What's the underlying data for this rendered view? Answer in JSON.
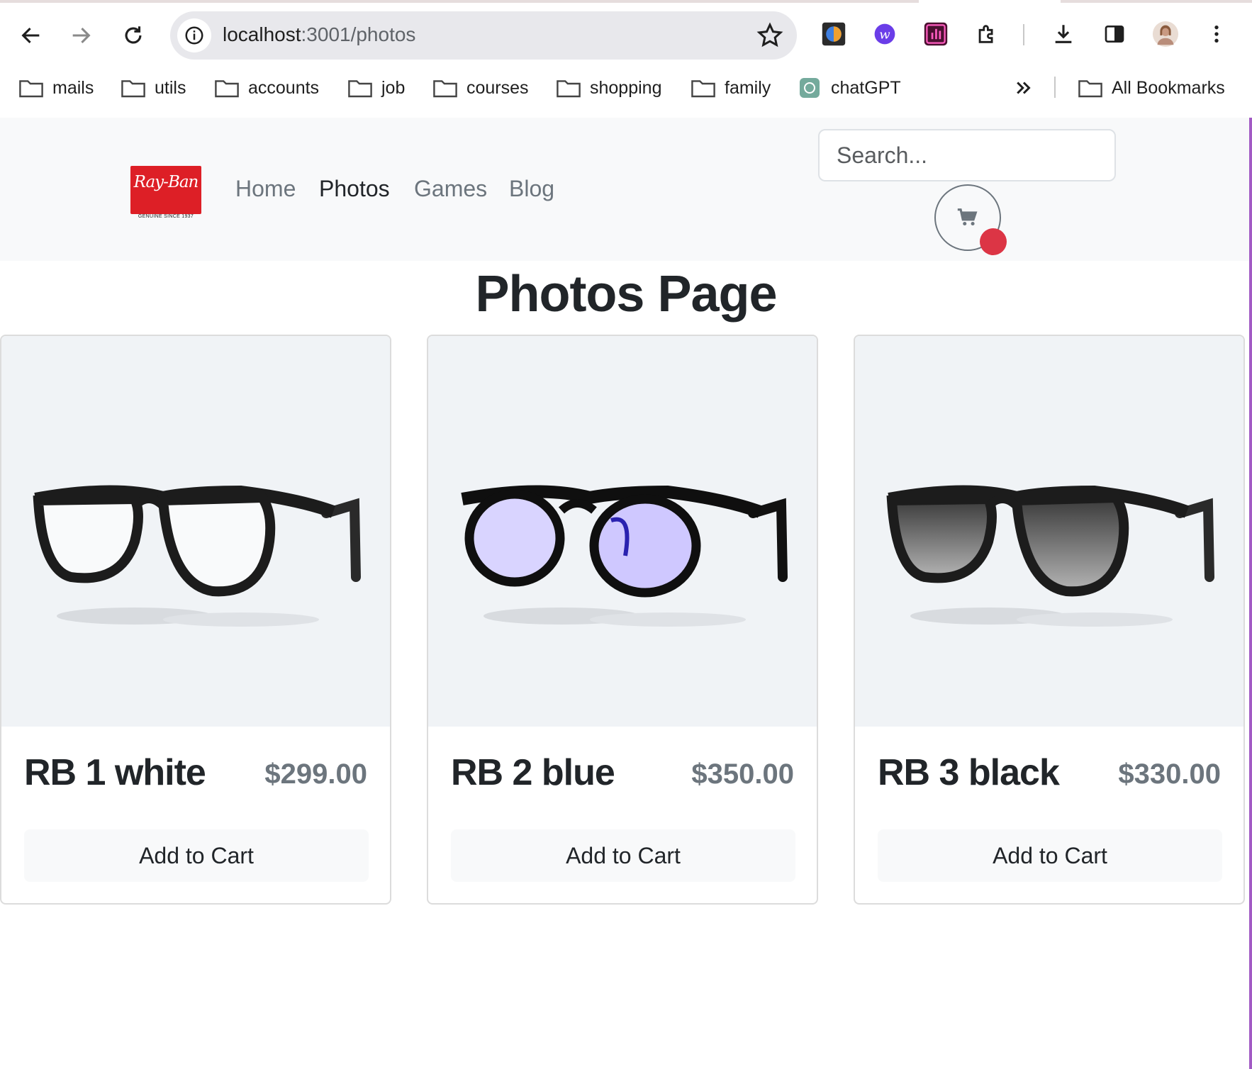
{
  "browser": {
    "url_host": "localhost",
    "url_path": ":3001/photos",
    "bookmarks": [
      {
        "label": "mails"
      },
      {
        "label": "utils"
      },
      {
        "label": "accounts"
      },
      {
        "label": "job"
      },
      {
        "label": "courses"
      },
      {
        "label": "shopping"
      },
      {
        "label": "family"
      },
      {
        "label": "chatGPT"
      }
    ],
    "all_bookmarks_label": "All Bookmarks"
  },
  "header": {
    "logo_text": "Ray-Ban",
    "logo_subtext": "GENUINE SINCE 1937",
    "nav": [
      {
        "label": "Home",
        "active": false
      },
      {
        "label": "Photos",
        "active": true
      },
      {
        "label": "Games",
        "active": false
      },
      {
        "label": "Blog",
        "active": false
      }
    ],
    "search_placeholder": "Search...",
    "cart_icon": "cart-icon"
  },
  "page": {
    "title": "Photos Page"
  },
  "products": [
    {
      "name": "RB 1 white",
      "price": "$299.00",
      "button_label": "Add to Cart",
      "lens": "clear"
    },
    {
      "name": "RB 2 blue",
      "price": "$350.00",
      "button_label": "Add to Cart",
      "lens": "blue"
    },
    {
      "name": "RB 3 black",
      "price": "$330.00",
      "button_label": "Add to Cart",
      "lens": "gradient-grey"
    }
  ],
  "colors": {
    "brand_red": "#dd1f26",
    "badge_red": "#dc3545",
    "muted_text": "#6c757d",
    "header_bg": "#f8f9fa",
    "image_bg": "#f0f3f6"
  }
}
